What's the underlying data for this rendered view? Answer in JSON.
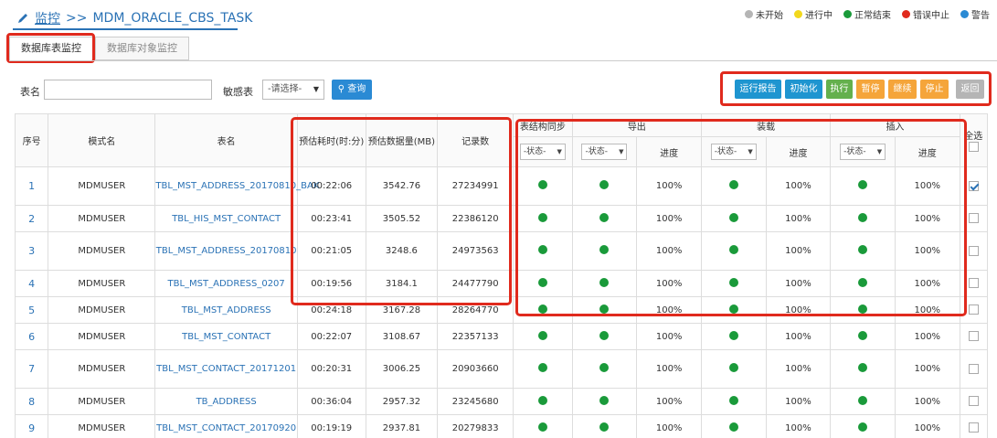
{
  "breadcrumb": {
    "root": "监控",
    "separator": ">>",
    "task": "MDM_ORACLE_CBS_TASK"
  },
  "legend": [
    {
      "label": "未开始",
      "color": "#b5b5b5"
    },
    {
      "label": "进行中",
      "color": "#f2d81c"
    },
    {
      "label": "正常结束",
      "color": "#1a9a3a"
    },
    {
      "label": "错误中止",
      "color": "#e02a1d"
    },
    {
      "label": "警告",
      "color": "#2a8ad4"
    }
  ],
  "tabs": [
    {
      "label": "数据库表监控",
      "active": true
    },
    {
      "label": "数据库对象监控",
      "active": false
    }
  ],
  "search": {
    "table_label": "表名",
    "table_value": "",
    "sensitive_label": "敏感表",
    "sensitive_value": "-请选择-",
    "query_label": "查询"
  },
  "actions": [
    {
      "label": "运行报告",
      "color": "#1e95d0"
    },
    {
      "label": "初始化",
      "color": "#1e95d0"
    },
    {
      "label": "执行",
      "color": "#64b04d"
    },
    {
      "label": "暂停",
      "color": "#f5a53a"
    },
    {
      "label": "继续",
      "color": "#f5a53a"
    },
    {
      "label": "停止",
      "color": "#f5a53a"
    },
    {
      "label": "返回",
      "color": "#b5b5b5"
    }
  ],
  "table": {
    "headers": {
      "seq": "序号",
      "schema": "模式名",
      "table": "表名",
      "est_time": "预估耗时(时:分)",
      "est_size": "预估数据量(MB)",
      "records": "记录数",
      "struct_sync": "表结构同步",
      "export": "导出",
      "load": "装载",
      "insert": "插入",
      "select_all": "全选",
      "status_filter": "-状态-",
      "progress": "进度"
    },
    "rows": [
      {
        "seq": "1",
        "schema": "MDMUSER",
        "table": "TBL_MST_ADDRESS_20170810_BAK",
        "time": "00:22:06",
        "size": "3542.76",
        "records": "27234991",
        "p1": "100%",
        "p2": "100%",
        "p3": "100%",
        "checked": true
      },
      {
        "seq": "2",
        "schema": "MDMUSER",
        "table": "TBL_HIS_MST_CONTACT",
        "time": "00:23:41",
        "size": "3505.52",
        "records": "22386120",
        "p1": "100%",
        "p2": "100%",
        "p3": "100%",
        "checked": false
      },
      {
        "seq": "3",
        "schema": "MDMUSER",
        "table": "TBL_MST_ADDRESS_20170810",
        "time": "00:21:05",
        "size": "3248.6",
        "records": "24973563",
        "p1": "100%",
        "p2": "100%",
        "p3": "100%",
        "checked": false
      },
      {
        "seq": "4",
        "schema": "MDMUSER",
        "table": "TBL_MST_ADDRESS_0207",
        "time": "00:19:56",
        "size": "3184.1",
        "records": "24477790",
        "p1": "100%",
        "p2": "100%",
        "p3": "100%",
        "checked": false
      },
      {
        "seq": "5",
        "schema": "MDMUSER",
        "table": "TBL_MST_ADDRESS",
        "time": "00:24:18",
        "size": "3167.28",
        "records": "28264770",
        "p1": "100%",
        "p2": "100%",
        "p3": "100%",
        "checked": false
      },
      {
        "seq": "6",
        "schema": "MDMUSER",
        "table": "TBL_MST_CONTACT",
        "time": "00:22:07",
        "size": "3108.67",
        "records": "22357133",
        "p1": "100%",
        "p2": "100%",
        "p3": "100%",
        "checked": false
      },
      {
        "seq": "7",
        "schema": "MDMUSER",
        "table": "TBL_MST_CONTACT_20171201",
        "time": "00:20:31",
        "size": "3006.25",
        "records": "20903660",
        "p1": "100%",
        "p2": "100%",
        "p3": "100%",
        "checked": false
      },
      {
        "seq": "8",
        "schema": "MDMUSER",
        "table": "TB_ADDRESS",
        "time": "00:36:04",
        "size": "2957.32",
        "records": "23245680",
        "p1": "100%",
        "p2": "100%",
        "p3": "100%",
        "checked": false
      },
      {
        "seq": "9",
        "schema": "MDMUSER",
        "table": "TBL_MST_CONTACT_20170920",
        "time": "00:19:19",
        "size": "2937.81",
        "records": "20279833",
        "p1": "100%",
        "p2": "100%",
        "p3": "100%",
        "checked": false
      }
    ]
  }
}
